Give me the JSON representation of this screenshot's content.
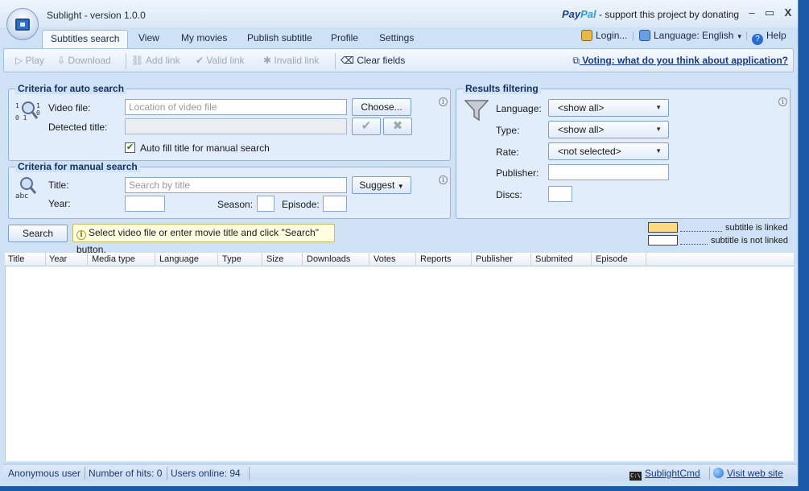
{
  "window": {
    "title": "Sublight - version 1.0.0",
    "paypal_brand_a": "Pay",
    "paypal_brand_b": "Pal",
    "paypal_text": " - support this project by donating",
    "minimize": "–",
    "maximize": "▭",
    "close": "X"
  },
  "menu": {
    "tabs": [
      "Subtitles search",
      "View",
      "My movies",
      "Publish subtitle",
      "Profile",
      "Settings"
    ],
    "login": "Login...",
    "language": "Language: English",
    "help": "Help"
  },
  "toolbar": {
    "play": "Play",
    "download": "Download",
    "add_link": "Add link",
    "valid_link": "Valid link",
    "invalid_link": "Invalid link",
    "clear_fields": "Clear fields",
    "voting": "Voting: what do you think about application?"
  },
  "auto_search": {
    "title": "Criteria for auto search",
    "video_file_label": "Video file:",
    "video_file_placeholder": "Location of video file",
    "choose_label": "Choose...",
    "detected_title_label": "Detected title:",
    "auto_fill_label": "Auto fill title for manual search",
    "auto_fill_checked": true
  },
  "manual_search": {
    "title": "Criteria for manual search",
    "title_label": "Title:",
    "title_placeholder": "Search by title",
    "suggest_label": "Suggest",
    "year_label": "Year:",
    "season_label": "Season:",
    "episode_label": "Episode:"
  },
  "filtering": {
    "title": "Results filtering",
    "language_label": "Language:",
    "language_value": "<show all>",
    "type_label": "Type:",
    "type_value": "<show all>",
    "rate_label": "Rate:",
    "rate_value": "<not selected>",
    "publisher_label": "Publisher:",
    "discs_label": "Discs:"
  },
  "search": {
    "button_label": "Search",
    "hint": "Select video file or enter movie title and click \"Search\" button."
  },
  "legend": {
    "linked": "subtitle is linked",
    "not_linked": "subtitle is not linked",
    "linked_color": "#ffd980",
    "not_linked_color": "#ffffff"
  },
  "grid": {
    "columns": [
      "Title",
      "Year",
      "Media type",
      "Language",
      "Type",
      "Size",
      "Downloads",
      "Votes",
      "Reports",
      "Publisher",
      "Submited",
      "Episode"
    ]
  },
  "status": {
    "user": "Anonymous user",
    "hits": "Number of hits: 0",
    "online": "Users online: 94",
    "cmd": "SublightCmd",
    "website": "Visit web site"
  },
  "colors": {
    "accent": "#1a5aa8",
    "panel": "#e1edfb",
    "window": "#cfe1f5"
  }
}
